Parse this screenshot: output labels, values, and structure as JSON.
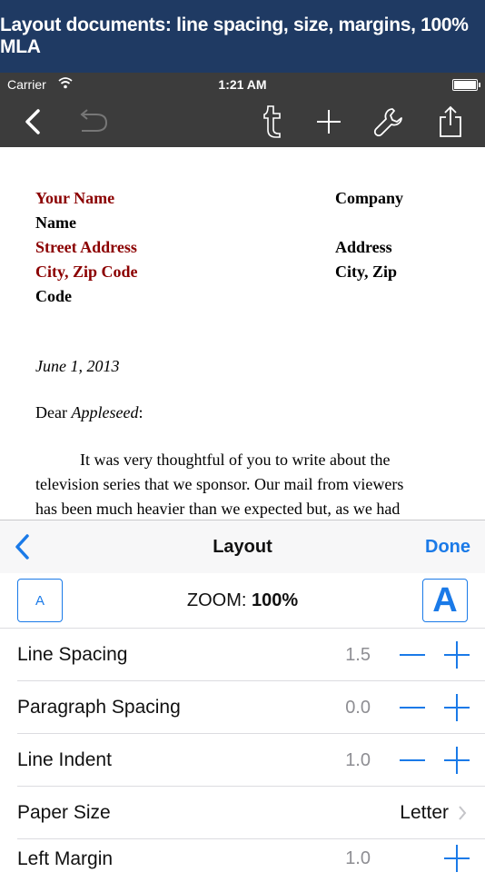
{
  "banner": {
    "text": "Layout documents: line spacing, size, margins, 100% MLA"
  },
  "status_bar": {
    "carrier": "Carrier",
    "time": "1:21 AM"
  },
  "toolbar": {
    "icons": [
      "back-chevron-icon",
      "undo-icon",
      "tumblr-icon",
      "plus-icon",
      "wrench-icon",
      "share-icon"
    ]
  },
  "document": {
    "your_name": "Your Name",
    "name": "Name",
    "company": "Company",
    "street": "Street Address",
    "address": "Address",
    "city_zip_code": "City, Zip Code",
    "code": "Code",
    "city_zip": "City, Zip",
    "date": "June 1, 2013",
    "salutation_prefix": "Dear ",
    "salutation_name": "Appleseed",
    "salutation_suffix": ":",
    "body_lines": [
      "It was very thoughtful of you to write about the",
      "television series that we sponsor. Our mail from viewers",
      "has been much heavier than we expected but, as we had"
    ]
  },
  "panel": {
    "title": "Layout",
    "done_label": "Done",
    "zoom_prefix": "ZOOM: ",
    "zoom_value": "100%",
    "small_a": "A",
    "big_a": "A",
    "rows": [
      {
        "label": "Line Spacing",
        "value": "1.5"
      },
      {
        "label": "Paragraph Spacing",
        "value": "0.0"
      },
      {
        "label": "Line Indent",
        "value": "1.0"
      },
      {
        "label": "Paper Size",
        "value": "Letter"
      },
      {
        "label": "Left Margin",
        "value": "1.0"
      }
    ]
  },
  "colors": {
    "accent": "#1a7ae8",
    "banner": "#1f3a63",
    "toolbar": "#3c3c3c",
    "placeholder_red": "#8b0000"
  }
}
